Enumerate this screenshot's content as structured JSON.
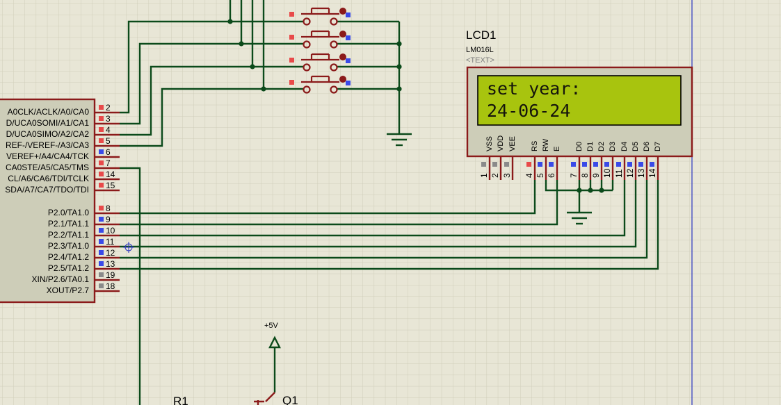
{
  "colors": {
    "background": "#e8e6d6",
    "grid": "#cfcdb9",
    "wire": "#0b4a1a",
    "component": "#8b1a1a",
    "component_fill": "#cdcdb8",
    "pin_red": "#e84a4a",
    "pin_blue": "#3a4ae8",
    "pin_grey": "#8a8a8a",
    "lcd_screen": "#a8c40e",
    "sheet_border": "#2a35c0"
  },
  "mcu": {
    "pins_top": [
      {
        "label": "A0CLK/ACLK/A0/CA0",
        "num": "2",
        "color": "red"
      },
      {
        "label": "D/UCA0SOMI/A1/CA1",
        "num": "3",
        "color": "red"
      },
      {
        "label": "D/UCA0SIMO/A2/CA2",
        "num": "4",
        "color": "red"
      },
      {
        "label": "REF-/VEREF-/A3/CA3",
        "num": "5",
        "color": "red"
      },
      {
        "label": "VEREF+/A4/CA4/TCK",
        "num": "6",
        "color": "blue"
      },
      {
        "label": "CA0STE/A5/CA5/TMS",
        "num": "7",
        "color": "red"
      },
      {
        "label": "CL/A6/CA6/TDI/TCLK",
        "num": "14",
        "color": "red"
      },
      {
        "label": "SDA/A7/CA7/TDO/TDI",
        "num": "15",
        "color": "red"
      }
    ],
    "pins_bottom": [
      {
        "label": "P2.0/TA1.0",
        "num": "8",
        "color": "red"
      },
      {
        "label": "P2.1/TA1.1",
        "num": "9",
        "color": "blue"
      },
      {
        "label": "P2.2/TA1.1",
        "num": "10",
        "color": "blue"
      },
      {
        "label": "P2.3/TA1.0",
        "num": "11",
        "color": "blue"
      },
      {
        "label": "P2.4/TA1.2",
        "num": "12",
        "color": "blue"
      },
      {
        "label": "P2.5/TA1.2",
        "num": "13",
        "color": "blue"
      },
      {
        "label": "XIN/P2.6/TA0.1",
        "num": "19",
        "color": "grey"
      },
      {
        "label": "XOUT/P2.7",
        "num": "18",
        "color": "grey"
      }
    ]
  },
  "lcd": {
    "reference": "LCD1",
    "value": "LM016L",
    "text_field": "<TEXT>",
    "line1": "set year:",
    "line2": "24-06-24",
    "pins": [
      {
        "name": "VSS",
        "num": "1",
        "color": "grey"
      },
      {
        "name": "VDD",
        "num": "2",
        "color": "grey"
      },
      {
        "name": "VEE",
        "num": "3",
        "color": "grey"
      },
      {
        "name": "RS",
        "num": "4",
        "color": "red"
      },
      {
        "name": "RW",
        "num": "5",
        "color": "blue"
      },
      {
        "name": "E",
        "num": "6",
        "color": "blue"
      },
      {
        "name": "D0",
        "num": "7",
        "color": "blue"
      },
      {
        "name": "D1",
        "num": "8",
        "color": "blue"
      },
      {
        "name": "D2",
        "num": "9",
        "color": "blue"
      },
      {
        "name": "D3",
        "num": "10",
        "color": "blue"
      },
      {
        "name": "D4",
        "num": "11",
        "color": "blue"
      },
      {
        "name": "D5",
        "num": "12",
        "color": "blue"
      },
      {
        "name": "D6",
        "num": "13",
        "color": "blue"
      },
      {
        "name": "D7",
        "num": "14",
        "color": "blue"
      }
    ]
  },
  "power": {
    "vcc_label": "+5V"
  },
  "labels": {
    "resistor": "R1",
    "transistor": "Q1"
  }
}
